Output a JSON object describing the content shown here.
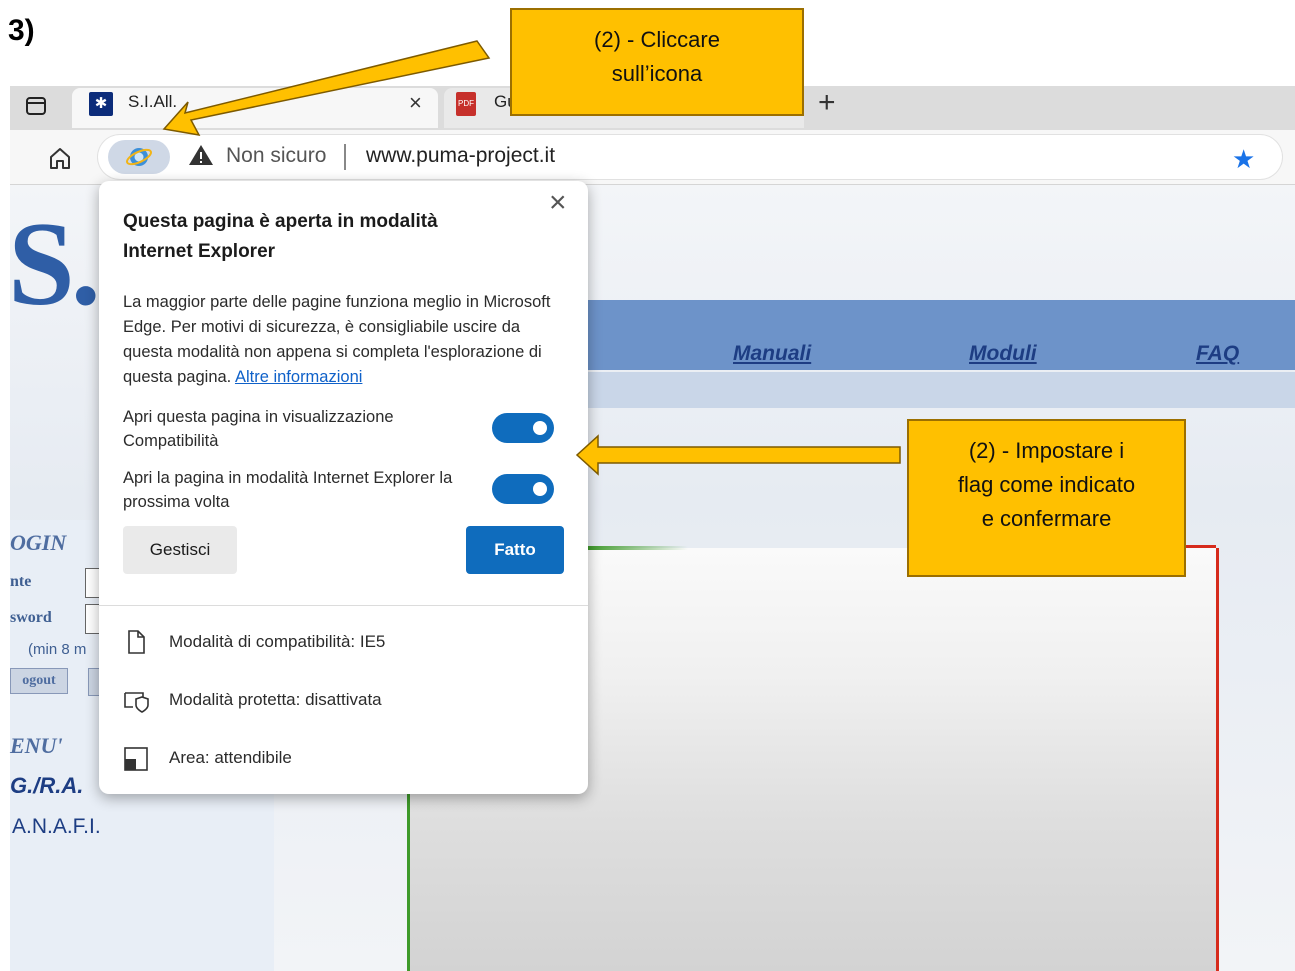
{
  "step_heading": "3)",
  "browser": {
    "tabs": [
      {
        "title": "S.I.All.",
        "close": "×"
      },
      {
        "title": "Gu"
      }
    ],
    "new_tab": "+",
    "address": {
      "security_text": "Non sicuro",
      "url": "www.puma-project.it"
    }
  },
  "page": {
    "nav": [
      "Manuali",
      "Moduli",
      "FAQ"
    ],
    "sidebar": {
      "login_title": "OGIN",
      "utente_label": "nte",
      "password_label": "sword",
      "min_note": "(min 8 m",
      "logout_button": "ogout",
      "menu_title": "ENU'",
      "gra_link": "G./R.A.",
      "anafi_link": "A.N.A.F.I."
    }
  },
  "popup": {
    "close": "×",
    "title": "Questa pagina è aperta in modalità Internet Explorer",
    "body": "La maggior parte delle pagine funziona meglio in Microsoft Edge. Per motivi di sicurezza, è consigliabile uscire da questa modalità non appena si completa l'esplorazione di questa pagina.",
    "link": "Altre informazioni",
    "options": [
      {
        "label": "Apri questa pagina in visualizzazione Compatibilità",
        "on": true
      },
      {
        "label": "Apri la pagina in modalità Internet Explorer la prossima volta",
        "on": true
      }
    ],
    "manage_button": "Gestisci",
    "done_button": "Fatto",
    "info": [
      {
        "icon": "document-icon",
        "text": "Modalità di compatibilità: IE5"
      },
      {
        "icon": "protected-shield-icon",
        "text": "Modalità protetta: disattivata"
      },
      {
        "icon": "zone-icon",
        "text": "Area: attendibile"
      }
    ]
  },
  "annotations": {
    "callout1": [
      "(2)  - Cliccare",
      "sull’icona"
    ],
    "callout2": [
      "(2) - Impostare i",
      "flag come indicato",
      "e confermare"
    ]
  },
  "colors": {
    "accent": "#0f6cbd",
    "callout": "#ffc000",
    "frame_left": "#3e9a2a",
    "frame_right": "#d62b1c"
  }
}
